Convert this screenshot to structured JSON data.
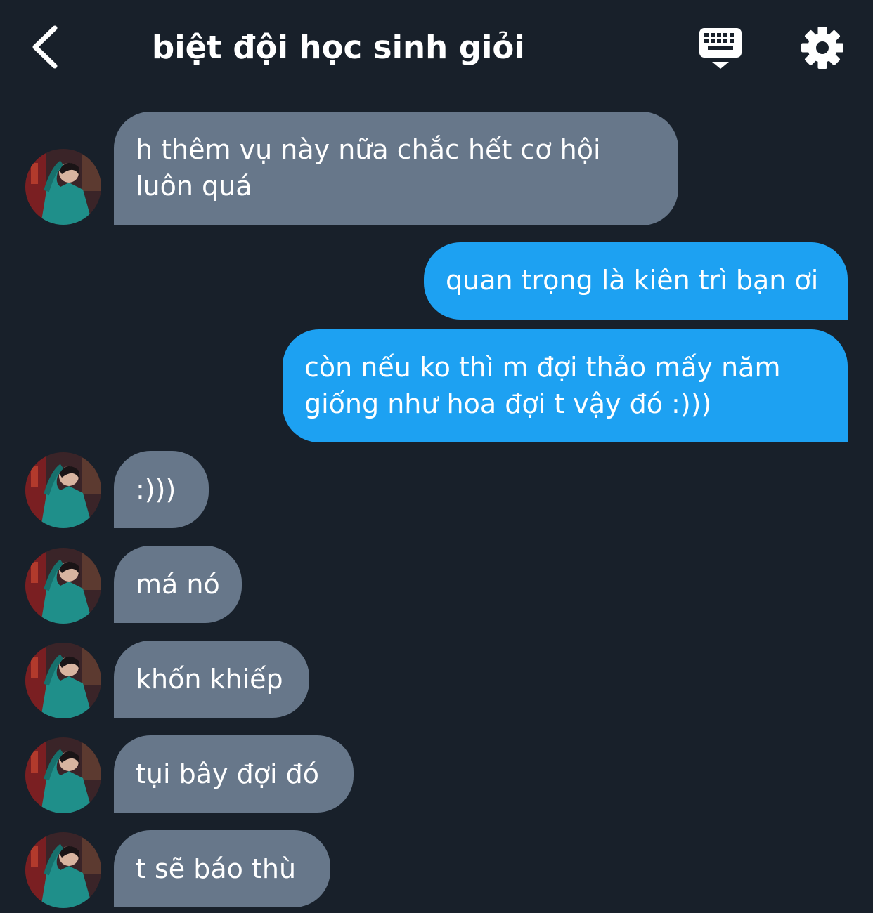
{
  "header": {
    "title": "biệt đội học sinh giỏi",
    "back_icon": "chevron-left-icon",
    "keyboard_icon": "keyboard-icon",
    "settings_icon": "gear-icon"
  },
  "colors": {
    "background": "#18202a",
    "incoming_bubble": "#67778a",
    "outgoing_bubble": "#1da1f2",
    "text": "#ffffff"
  },
  "messages": [
    {
      "direction": "incoming",
      "lines": [
        "h thêm vụ này nữa chắc hết cơ hội",
        "luôn quá"
      ]
    },
    {
      "direction": "outgoing",
      "lines": [
        "quan trọng là kiên trì bạn ơi"
      ]
    },
    {
      "direction": "outgoing",
      "lines": [
        "còn nếu ko thì m đợi thảo mấy năm",
        "giống như hoa đợi t vậy đó :)))"
      ]
    },
    {
      "direction": "incoming",
      "lines": [
        ":)))"
      ]
    },
    {
      "direction": "incoming",
      "lines": [
        "má nó"
      ]
    },
    {
      "direction": "incoming",
      "lines": [
        "khốn khiếp"
      ]
    },
    {
      "direction": "incoming",
      "lines": [
        "tụi bây đợi đó"
      ]
    },
    {
      "direction": "incoming",
      "lines": [
        "t sẽ báo thù"
      ]
    }
  ]
}
